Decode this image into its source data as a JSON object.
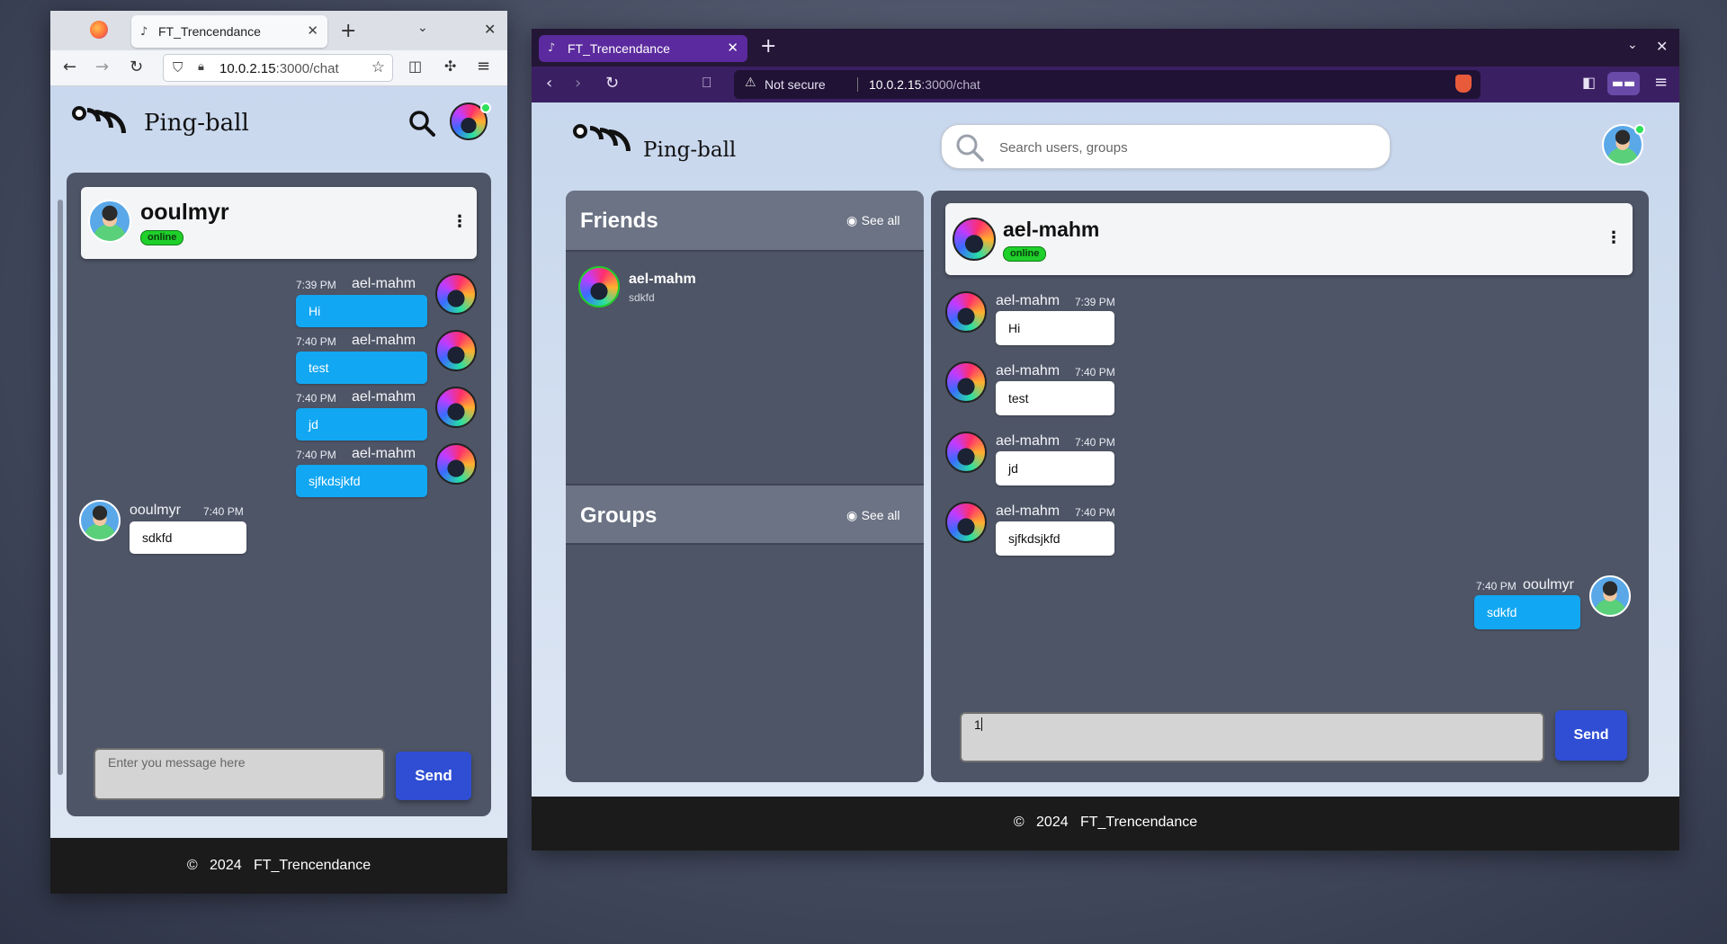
{
  "left_browser": {
    "tab_title": "FT_Trencendance",
    "url_host": "10.0.2.15",
    "url_path": ":3000/chat",
    "brand": "Ping-ball",
    "chat_header": {
      "name": "ooulmyr",
      "status": "online"
    },
    "messages": [
      {
        "time": "7:39 PM",
        "author": "ael-mahm",
        "text": "Hi"
      },
      {
        "time": "7:40 PM",
        "author": "ael-mahm",
        "text": "test"
      },
      {
        "time": "7:40 PM",
        "author": "ael-mahm",
        "text": "jd"
      },
      {
        "time": "7:40 PM",
        "author": "ael-mahm",
        "text": "sjfkdsjkfd"
      },
      {
        "time": "7:40 PM",
        "author": "ooulmyr",
        "text": "sdkfd"
      }
    ],
    "input_placeholder": "Enter you message here",
    "send_label": "Send",
    "footer": {
      "copyright": "©",
      "year": "2024",
      "name": "FT_Trencendance"
    }
  },
  "right_browser": {
    "tab_title": "FT_Trencendance",
    "security_text": "Not secure",
    "url_host": "10.0.2.15",
    "url_path": ":3000/chat",
    "brand": "Ping-ball",
    "search_placeholder": "Search users, groups",
    "friends": {
      "title": "Friends",
      "see_all": "See all",
      "items": [
        {
          "name": "ael-mahm",
          "last_message": "sdkfd"
        }
      ]
    },
    "groups": {
      "title": "Groups",
      "see_all": "See all"
    },
    "chat_header": {
      "name": "ael-mahm",
      "status": "online"
    },
    "messages": [
      {
        "time": "7:39 PM",
        "author": "ael-mahm",
        "text": "Hi"
      },
      {
        "time": "7:40 PM",
        "author": "ael-mahm",
        "text": "test"
      },
      {
        "time": "7:40 PM",
        "author": "ael-mahm",
        "text": "jd"
      },
      {
        "time": "7:40 PM",
        "author": "ael-mahm",
        "text": "sjfkdsjkfd"
      },
      {
        "time": "7:40 PM",
        "author": "ooulmyr",
        "text": "sdkfd"
      }
    ],
    "input_value": "1",
    "send_label": "Send",
    "footer": {
      "copyright": "©",
      "year": "2024",
      "name": "FT_Trencendance"
    }
  },
  "icons": {
    "search": "search-icon",
    "kebab": "more-vertical-icon",
    "eye": "eye-icon",
    "close": "close-icon",
    "plus": "new-tab-icon"
  }
}
